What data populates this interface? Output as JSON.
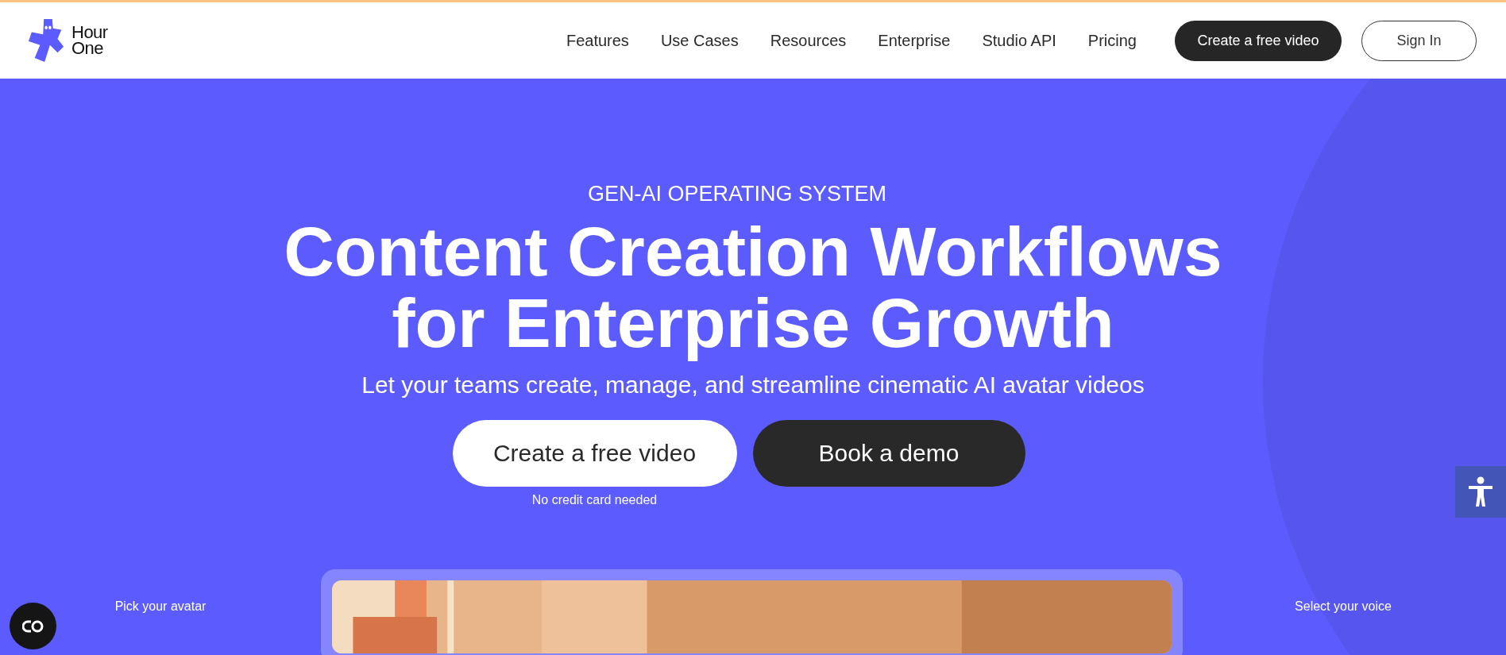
{
  "header": {
    "logo_text": [
      "Hour",
      "One"
    ],
    "nav": [
      {
        "label": "Features"
      },
      {
        "label": "Use Cases"
      },
      {
        "label": "Resources"
      },
      {
        "label": "Enterprise"
      },
      {
        "label": "Studio API"
      },
      {
        "label": "Pricing"
      }
    ],
    "buttons": [
      {
        "label": "Create a free video",
        "kind": "primary"
      },
      {
        "label": "Sign In",
        "kind": "outline"
      }
    ]
  },
  "hero": {
    "eyebrow": "GEN-AI OPERATING SYSTEM",
    "headline": [
      "Content Creation Workflows",
      "for Enterprise Growth"
    ],
    "subtitle": "Let your teams create, manage, and streamline cinematic AI avatar videos",
    "buttons": [
      {
        "label": "Create a free video",
        "kind": "light"
      },
      {
        "label": "Book a demo",
        "kind": "dark"
      }
    ],
    "note": "No credit card needed",
    "side_labels": [
      "Pick your avatar",
      "Select your voice"
    ]
  }
}
